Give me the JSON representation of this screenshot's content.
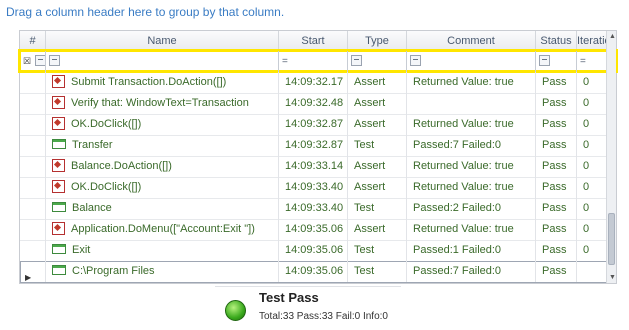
{
  "group_hint": "Drag a column header here to group by that column.",
  "columns": [
    "#",
    "Name",
    "Start",
    "Type",
    "Comment",
    "Status",
    "Iteration"
  ],
  "filter_row": {
    "name_op": "=",
    "start_op": "=",
    "iteration_op": "="
  },
  "rows": [
    {
      "icon": "error-icon",
      "name": "Submit Transaction.DoAction([])",
      "start": "14:09:32.17",
      "type": "Assert",
      "comment": "Returned Value: true",
      "status": "Pass",
      "iteration": "0"
    },
    {
      "icon": "error-icon",
      "name": "Verify that: WindowText=Transaction",
      "start": "14:09:32.48",
      "type": "Assert",
      "comment": "",
      "status": "Pass",
      "iteration": "0"
    },
    {
      "icon": "error-icon",
      "name": "OK.DoClick([])",
      "start": "14:09:32.87",
      "type": "Assert",
      "comment": "Returned Value: true",
      "status": "Pass",
      "iteration": "0"
    },
    {
      "icon": "window-icon",
      "name": "Transfer",
      "start": "14:09:32.87",
      "type": "Test",
      "comment": "Passed:7 Failed:0",
      "status": "Pass",
      "iteration": "0"
    },
    {
      "icon": "error-icon",
      "name": "Balance.DoAction([])",
      "start": "14:09:33.14",
      "type": "Assert",
      "comment": "Returned Value: true",
      "status": "Pass",
      "iteration": "0"
    },
    {
      "icon": "error-icon",
      "name": "OK.DoClick([])",
      "start": "14:09:33.40",
      "type": "Assert",
      "comment": "Returned Value: true",
      "status": "Pass",
      "iteration": "0"
    },
    {
      "icon": "window-icon",
      "name": "Balance",
      "start": "14:09:33.40",
      "type": "Test",
      "comment": "Passed:2 Failed:0",
      "status": "Pass",
      "iteration": "0"
    },
    {
      "icon": "error-icon",
      "name": "Application.DoMenu([\"Account:Exit \"])",
      "start": "14:09:35.06",
      "type": "Assert",
      "comment": "Returned Value: true",
      "status": "Pass",
      "iteration": "0"
    },
    {
      "icon": "window-icon",
      "name": "Exit",
      "start": "14:09:35.06",
      "type": "Test",
      "comment": "Passed:1 Failed:0",
      "status": "Pass",
      "iteration": "0"
    },
    {
      "icon": "window-icon",
      "name": "C:\\Program Files",
      "start": "14:09:35.06",
      "type": "Test",
      "comment": "Passed:7 Failed:0",
      "status": "Pass",
      "iteration": ""
    }
  ],
  "summary": {
    "title": "Test Pass",
    "stats": "Total:33 Pass:33 Fail:0 Info:0",
    "status_color": "#3aa91d"
  }
}
